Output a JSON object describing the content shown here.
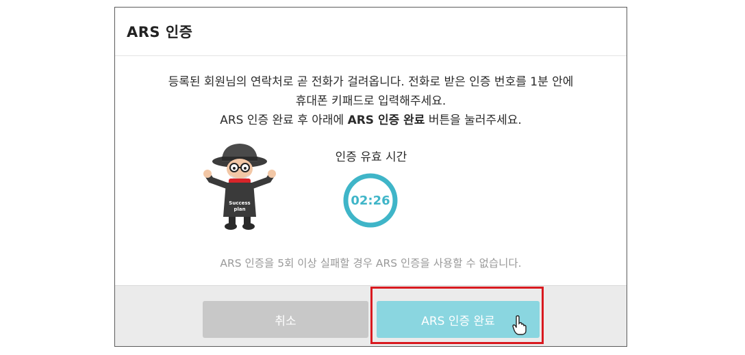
{
  "dialog": {
    "title": "ARS 인증",
    "message": {
      "line1": "등록된 회원님의 연락처로 곧 전화가 걸려옵니다. 전화로 받은 인증 번호를 1분 안에",
      "line2": "휴대폰 키패드로 입력해주세요.",
      "line3_prefix": "ARS 인증 완료 후 아래에 ",
      "line3_bold": "ARS 인증 완료",
      "line3_suffix": " 버튼을 눌러주세요."
    },
    "character": {
      "shirt_text_1": "Success",
      "shirt_text_2": "plan"
    },
    "timer": {
      "label": "인증 유효 시간",
      "value": "02:26",
      "remaining_fraction": 1.0,
      "color": "#3fb5c8"
    },
    "warning": "ARS 인증을 5회 이상 실패할 경우 ARS 인증을 사용할 수 없습니다.",
    "buttons": {
      "cancel": "취소",
      "complete": "ARS 인증 완료"
    }
  },
  "colors": {
    "accent": "#8ad6e0",
    "cancel": "#c8c8c8",
    "highlight": "#d9191f"
  }
}
